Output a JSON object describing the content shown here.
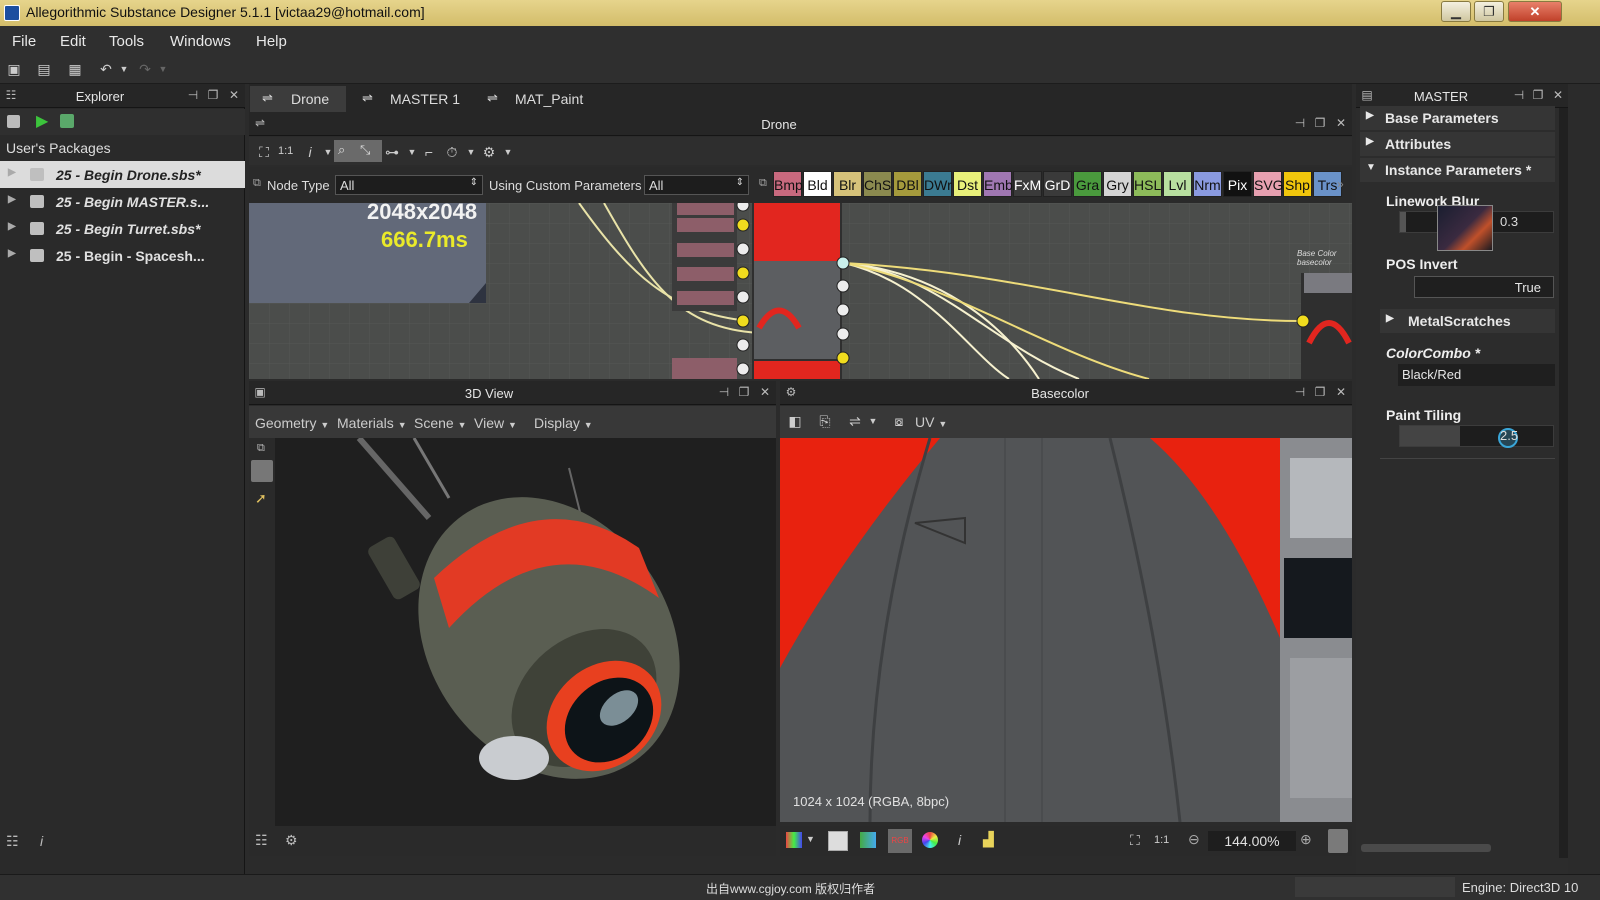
{
  "app": {
    "title": "Allegorithmic Substance Designer 5.1.1 [victaa29@hotmail.com]"
  },
  "menu": [
    "File",
    "Edit",
    "Tools",
    "Windows",
    "Help"
  ],
  "explorer": {
    "title": "Explorer",
    "section": "User's Packages",
    "packages": [
      "25 - Begin Drone.sbs*",
      "25 - Begin MASTER.s...",
      "25 - Begin Turret.sbs*",
      "25 - Begin - Spacesh..."
    ]
  },
  "tabs": [
    "Drone",
    "MASTER 1",
    "MAT_Paint"
  ],
  "graph": {
    "title": "Drone",
    "zoom_label": "1:1",
    "node_type_label": "Node Type",
    "node_type_value": "All",
    "custom_params_label": "Using Custom Parameters",
    "custom_params_value": "All",
    "swatches": [
      {
        "t": "Bmp",
        "c": "#c8697e"
      },
      {
        "t": "Bld",
        "c": "#ffffff"
      },
      {
        "t": "Blr",
        "c": "#d6c27a"
      },
      {
        "t": "ChS",
        "c": "#8b8a4f"
      },
      {
        "t": "DBl",
        "c": "#a59a3c"
      },
      {
        "t": "DWr",
        "c": "#3b7b92"
      },
      {
        "t": "Dst",
        "c": "#e8f07a"
      },
      {
        "t": "Emb",
        "c": "#a077b2"
      },
      {
        "t": "FxM",
        "c": "#3a3a3a"
      },
      {
        "t": "GrD",
        "c": "#3a3a3a"
      },
      {
        "t": "Gra",
        "c": "#4a9a3d"
      },
      {
        "t": "Gry",
        "c": "#d4d4d4"
      },
      {
        "t": "HSL",
        "c": "#8dbb5a"
      },
      {
        "t": "Lvl",
        "c": "#b8e0a0"
      },
      {
        "t": "Nrm",
        "c": "#8a9ae0"
      },
      {
        "t": "Pix",
        "c": "#111111"
      },
      {
        "t": "SVG",
        "c": "#e7a0b0"
      },
      {
        "t": "Shp",
        "c": "#f1c60c"
      },
      {
        "t": "Trs",
        "c": "#6a92c8"
      }
    ],
    "resolution": "2048x2048",
    "time": "666.7ms",
    "node_label": "Base Color basecolor"
  },
  "view3d": {
    "title": "3D View",
    "menus": [
      "Geometry",
      "Materials",
      "Scene",
      "View",
      "Display"
    ]
  },
  "view2d": {
    "title": "Basecolor",
    "uv_label": "UV",
    "info": "1024 x 1024 (RGBA, 8bpc)",
    "zoom_label": "1:1",
    "zoom": "144.00%"
  },
  "params": {
    "title": "MASTER",
    "sections": {
      "base": "Base Parameters",
      "attributes": "Attributes",
      "instance": "Instance Parameters *"
    },
    "linework_blur": {
      "label": "Linework Blur",
      "value": "0.3"
    },
    "pos_invert": {
      "label": "POS Invert",
      "value": "True"
    },
    "metal_scratches": "MetalScratches",
    "color_combo": {
      "label": "ColorCombo *",
      "value": "Black/Red"
    },
    "paint_tiling": {
      "label": "Paint Tiling",
      "value": "2.5"
    }
  },
  "status": {
    "watermark": "出自www.cgjoy.com 版权归作者",
    "engine": "Engine: Direct3D 10"
  }
}
